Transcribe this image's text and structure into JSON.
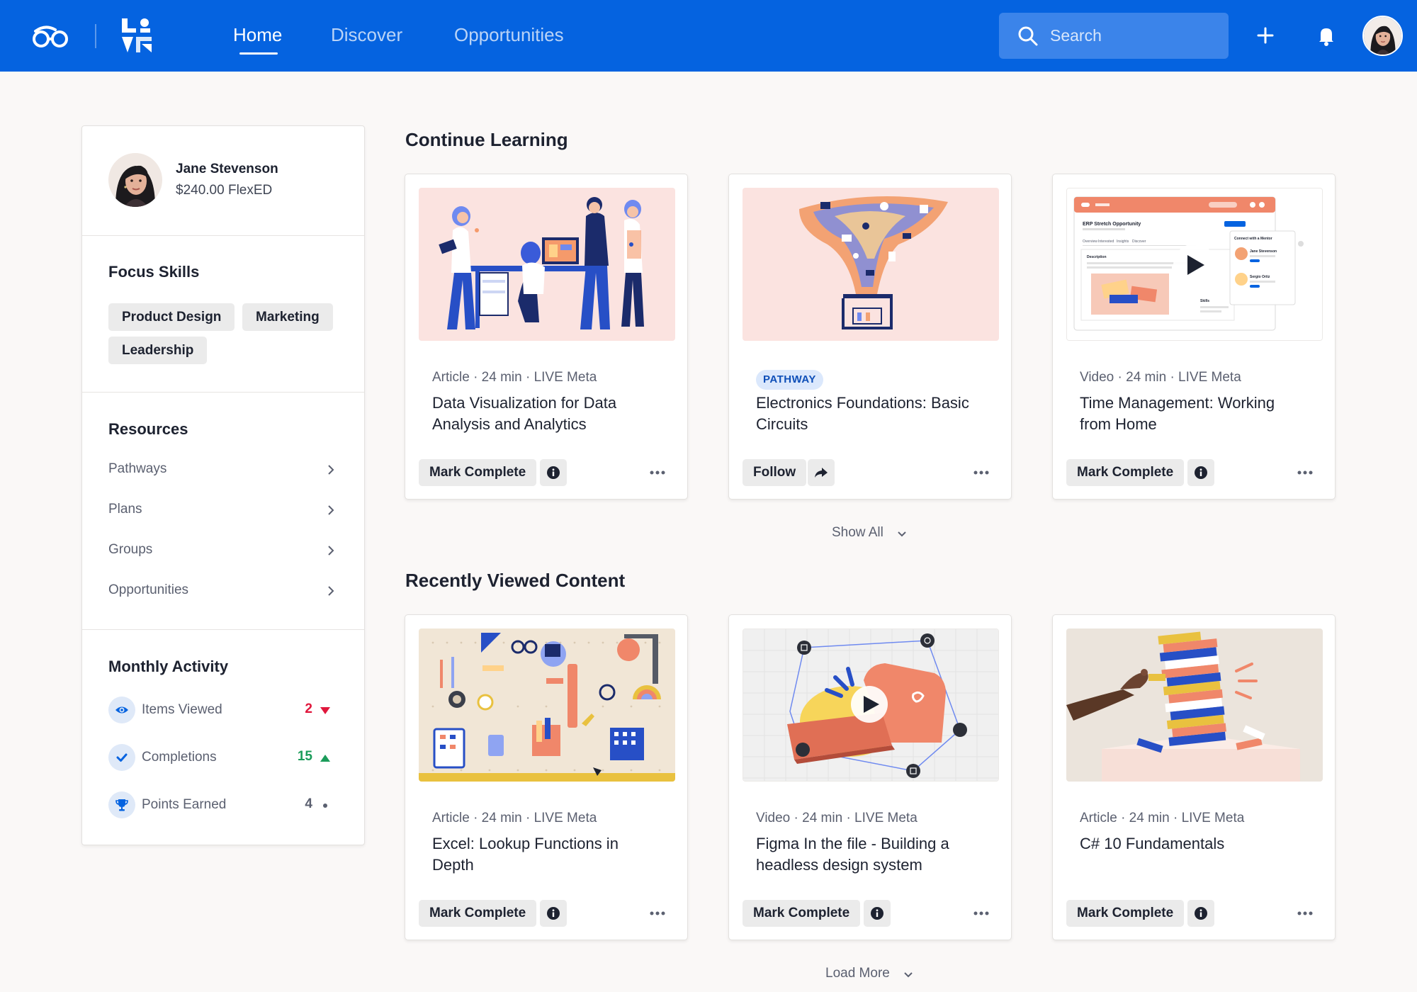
{
  "topbar": {
    "nav": [
      "Home",
      "Discover",
      "Opportunities"
    ],
    "active_nav": "Home",
    "search_placeholder": "Search",
    "brand_color": "#0563e0"
  },
  "profile": {
    "name": "Jane Stevenson",
    "balance": "$240.00 FlexED"
  },
  "focus_skills": {
    "heading": "Focus Skills",
    "skills": [
      "Product Design",
      "Marketing",
      "Leadership"
    ]
  },
  "resources": {
    "heading": "Resources",
    "items": [
      "Pathways",
      "Plans",
      "Groups",
      "Opportunities"
    ]
  },
  "monthly_activity": {
    "heading": "Monthly Activity",
    "rows": [
      {
        "label": "Items Viewed",
        "value": "2",
        "trend": "down",
        "color": "#e0173c"
      },
      {
        "label": "Completions",
        "value": "15",
        "trend": "up",
        "color": "#1b9c5a"
      },
      {
        "label": "Points Earned",
        "value": "4",
        "trend": "neutral",
        "color": "#5b6070"
      }
    ]
  },
  "continue_learning": {
    "title": "Continue Learning",
    "cards": [
      {
        "meta": "Article · 24 min · LIVE Meta",
        "badge": "",
        "title": "Data Visualization for Data Analysis and Analytics",
        "action": "Mark Complete",
        "secondary_icon": "info-icon"
      },
      {
        "meta": "",
        "badge": "PATHWAY",
        "title": "Electronics Foundations: Basic Circuits",
        "action": "Follow",
        "secondary_icon": "share-icon"
      },
      {
        "meta": "Video · 24 min · LIVE Meta",
        "badge": "",
        "title": "Time Management: Working from Home",
        "action": "Mark Complete",
        "secondary_icon": "info-icon"
      }
    ],
    "show_all": "Show All"
  },
  "recently_viewed": {
    "title": "Recently Viewed Content",
    "cards": [
      {
        "meta": "Article · 24 min · LIVE Meta",
        "title": "Excel: Lookup Functions in Depth",
        "action": "Mark Complete",
        "secondary_icon": "info-icon"
      },
      {
        "meta": "Video · 24 min · LIVE Meta",
        "title": "Figma In the file - Building a headless design system",
        "action": "Mark Complete",
        "secondary_icon": "info-icon"
      },
      {
        "meta": "Article · 24 min · LIVE Meta",
        "title": "C# 10 Fundamentals",
        "action": "Mark Complete",
        "secondary_icon": "info-icon"
      }
    ],
    "load_more": "Load More"
  },
  "thumbnail_mock": {
    "title": "ERP Stretch Opportunity",
    "tabs": [
      "Overview",
      "Interested",
      "Insights",
      "Discover"
    ],
    "side_heading": "Connect with a Mentor",
    "mentors": [
      "Jane Stevenson",
      "Sergio Ortiz"
    ],
    "description_label": "Description",
    "skills_label": "Skills"
  }
}
